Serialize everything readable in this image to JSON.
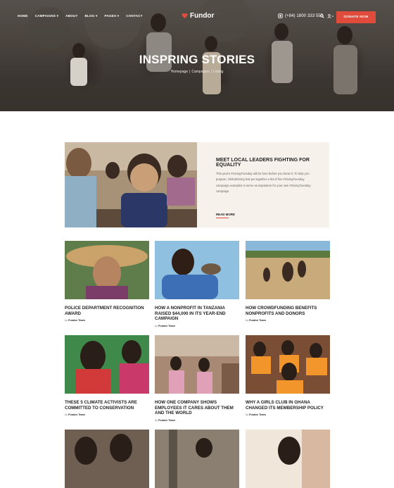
{
  "nav": {
    "menu": [
      "HOME",
      "CAMPAIGNS",
      "ABOUT",
      "BLOG",
      "PAGES",
      "CONTACT"
    ],
    "logo": "Fundor",
    "phone": "(+84) 1800 333 555",
    "donate": "DONATE NOW",
    "colors": {
      "accent": "#e14b3b"
    }
  },
  "hero": {
    "title": "INSPRING STORIES",
    "breadcrumb": [
      "Homepage",
      "Campaigns",
      "Listing"
    ]
  },
  "feature": {
    "title": "MEET LOCAL LEADERS FIGHTING FOR EQUALITY",
    "text": "This year's #GivingTuesday will be here before you know it. To help you prepare, GlobalGiving has put together a list of five #GivingTuesday campaign examples to serve as inspiration for your own #GivingTuesday campaign.",
    "read_more": "READ MORE"
  },
  "cards": [
    {
      "title": "POLICE DEPARTMENT RECOGNITION AWARD",
      "by": "by",
      "author": "Fundor Team"
    },
    {
      "title": "HOW A NONPROFIT IN TANZANIA RAISED $44,000 IN ITS YEAR-END CAMPAIGN",
      "by": "by",
      "author": "Fundor Team"
    },
    {
      "title": "HOW CROWDFUNDING BENEFITS NONPROFITS AND DONORS",
      "by": "by",
      "author": "Fundor Team"
    },
    {
      "title": "THESE 5 CLIMATE ACTIVISTS ARE COMMITTED TO CONSERVATION",
      "by": "by",
      "author": "Fundor Team"
    },
    {
      "title": "HOW ONE COMPANY SHOWS EMPLOYEES IT CARES ABOUT THEM AND THE WORLD",
      "by": "by",
      "author": "Fundor Team"
    },
    {
      "title": "WHY A GIRLS CLUB IN GHANA CHANGED ITS MEMBERSHIP POLICY",
      "by": "by",
      "author": "Fundor Team"
    }
  ],
  "icons": [
    "heart-logo-icon",
    "phone-icon",
    "search-icon",
    "user-icon",
    "chevron-down-icon"
  ]
}
